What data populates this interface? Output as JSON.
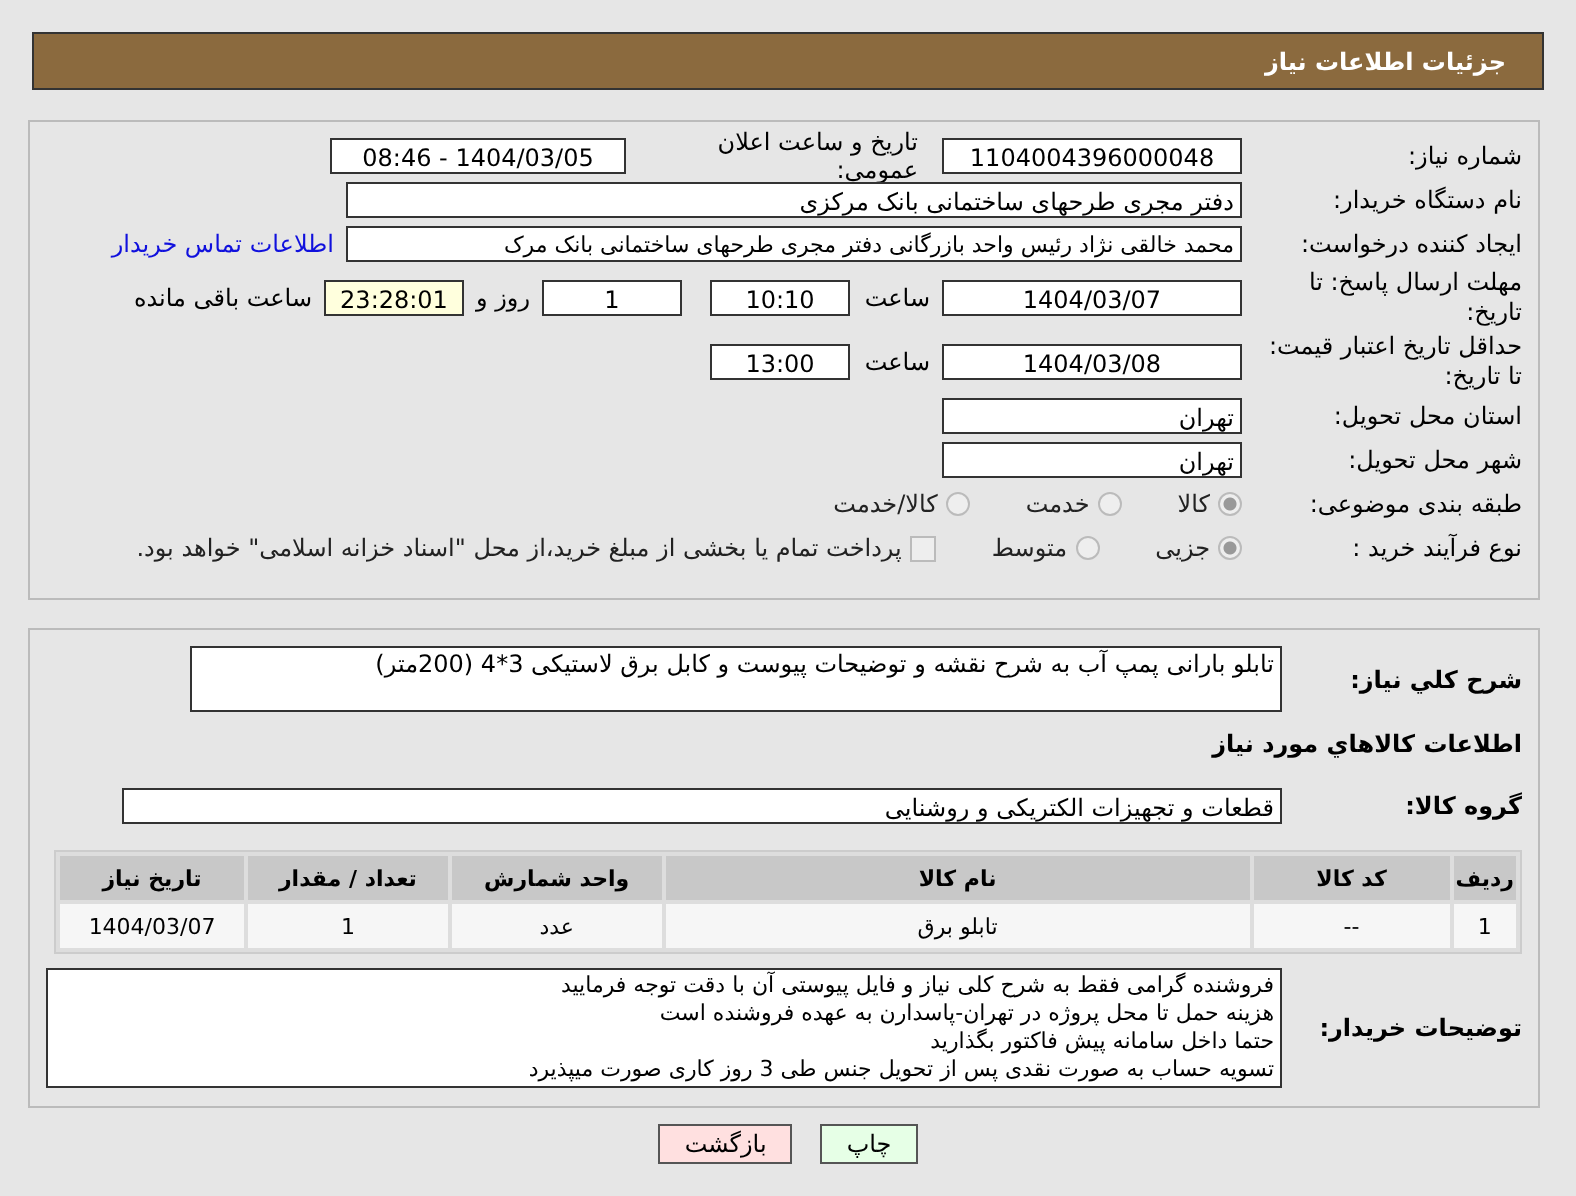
{
  "header": {
    "title": "جزئیات اطلاعات نیاز"
  },
  "fields": {
    "need_number": {
      "label": "شماره نیاز:",
      "value": "1104004396000048"
    },
    "announce": {
      "label": "تاریخ و ساعت اعلان عمومی:",
      "value": "1404/03/05 - 08:46"
    },
    "buyer": {
      "label": "نام دستگاه خریدار:",
      "value": "دفتر مجری طرحهای ساختمانی بانک مرکزی"
    },
    "requester": {
      "label": "ایجاد کننده درخواست:",
      "value": "محمد خالقی نژاد رئیس واحد بازرگانی دفتر مجری طرحهای ساختمانی بانک مرک",
      "link": "اطلاعات تماس خریدار"
    },
    "deadline": {
      "label": "مهلت ارسال پاسخ: تا تاریخ:",
      "date": "1404/03/07",
      "time_label": "ساعت",
      "time": "10:10",
      "days": "1",
      "days_label": "روز و",
      "remaining": "23:28:01",
      "remaining_label": "ساعت باقی مانده"
    },
    "validity": {
      "label": "حداقل تاریخ اعتبار قیمت: تا تاریخ:",
      "date": "1404/03/08",
      "time_label": "ساعت",
      "time": "13:00"
    },
    "province": {
      "label": "استان محل تحویل:",
      "value": "تهران"
    },
    "city": {
      "label": "شهر محل تحویل:",
      "value": "تهران"
    },
    "category": {
      "label": "طبقه بندی موضوعی:",
      "options": [
        {
          "label": "کالا",
          "selected": true
        },
        {
          "label": "خدمت",
          "selected": false
        },
        {
          "label": "کالا/خدمت",
          "selected": false
        }
      ]
    },
    "process": {
      "label": "نوع فرآیند خرید :",
      "options": [
        {
          "label": "جزیی",
          "selected": true
        },
        {
          "label": "متوسط",
          "selected": false
        }
      ],
      "payment": {
        "label": "پرداخت تمام یا بخشی از مبلغ خرید،از محل \"اسناد خزانه اسلامی\" خواهد بود.",
        "checked": false
      }
    }
  },
  "description": {
    "label": "شرح کلي نياز:",
    "value": "تابلو بارانی پمپ آب به شرح نقشه و توضیحات پیوست و کابل برق لاستیکی 3*4 (200متر)"
  },
  "goods_title": "اطلاعات كالاهاي مورد نياز",
  "goods_group": {
    "label": "گروه کالا:",
    "value": "قطعات و تجهیزات الکتریکی و روشنایی"
  },
  "table": {
    "columns": [
      "ردیف",
      "کد کالا",
      "نام کالا",
      "واحد شمارش",
      "تعداد / مقدار",
      "تاریخ نیاز"
    ],
    "rows": [
      [
        "1",
        "--",
        "تابلو برق",
        "عدد",
        "1",
        "1404/03/07"
      ]
    ]
  },
  "buyer_notes": {
    "label": "توضیحات خریدار:",
    "lines": [
      "فروشنده گرامی فقط به شرح کلی نیاز و فایل پیوستی آن با دقت توجه فرمایید",
      "هزینه حمل تا محل پروژه در تهران-پاسدارن به عهده فروشنده است",
      "حتما داخل سامانه پیش فاکتور بگذارید",
      "تسویه حساب به صورت نقدی پس از تحویل جنس طی 3 روز کاری صورت میپذیرد"
    ]
  },
  "buttons": [
    {
      "label": "چاپ",
      "kind": "print"
    },
    {
      "label": "بازگشت",
      "kind": "back"
    }
  ]
}
